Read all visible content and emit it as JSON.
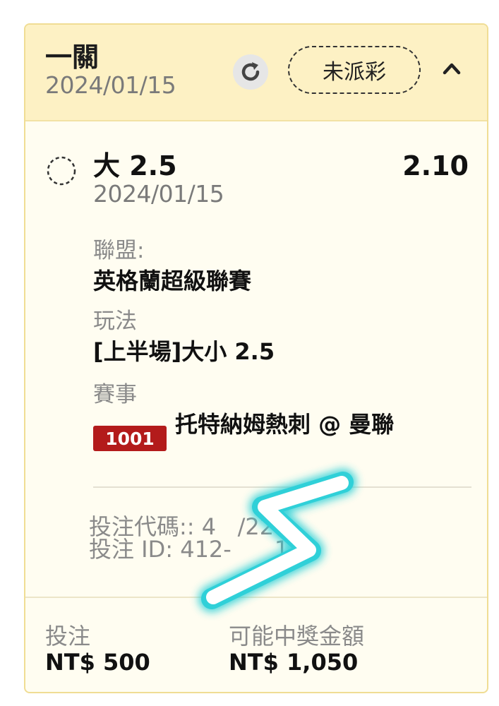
{
  "ticket": {
    "bet_type": "一關",
    "date": "2024/01/15",
    "status": "未派彩",
    "icons": {
      "refresh": "refresh-icon",
      "collapse": "chevron-up-icon",
      "pending": "pending-circle-icon"
    }
  },
  "selection": {
    "name": "大 2.5",
    "odds": "2.10",
    "date": "2024/01/15",
    "league_label": "聯盟:",
    "league": "英格蘭超級聯賽",
    "market_label": "玩法",
    "market": "[上半場]大小 2.5",
    "event_label": "賽事",
    "match_id": "1001",
    "match": "托特納姆熱刺 @ 曼聯"
  },
  "codes": {
    "bet_code": "投注代碼:: 4   /227",
    "bet_id": "投注 ID: 412-      1"
  },
  "footer": {
    "stake_label": "投注",
    "stake": "NT$ 500",
    "payout_label": "可能中獎金額",
    "payout": "NT$ 1,050"
  },
  "colors": {
    "header_bg": "#fdf1c4",
    "card_bg": "#fffdf1",
    "border": "#f0dd94",
    "match_id_badge": "#b31b1b",
    "scribble": "#2fd0d8"
  }
}
